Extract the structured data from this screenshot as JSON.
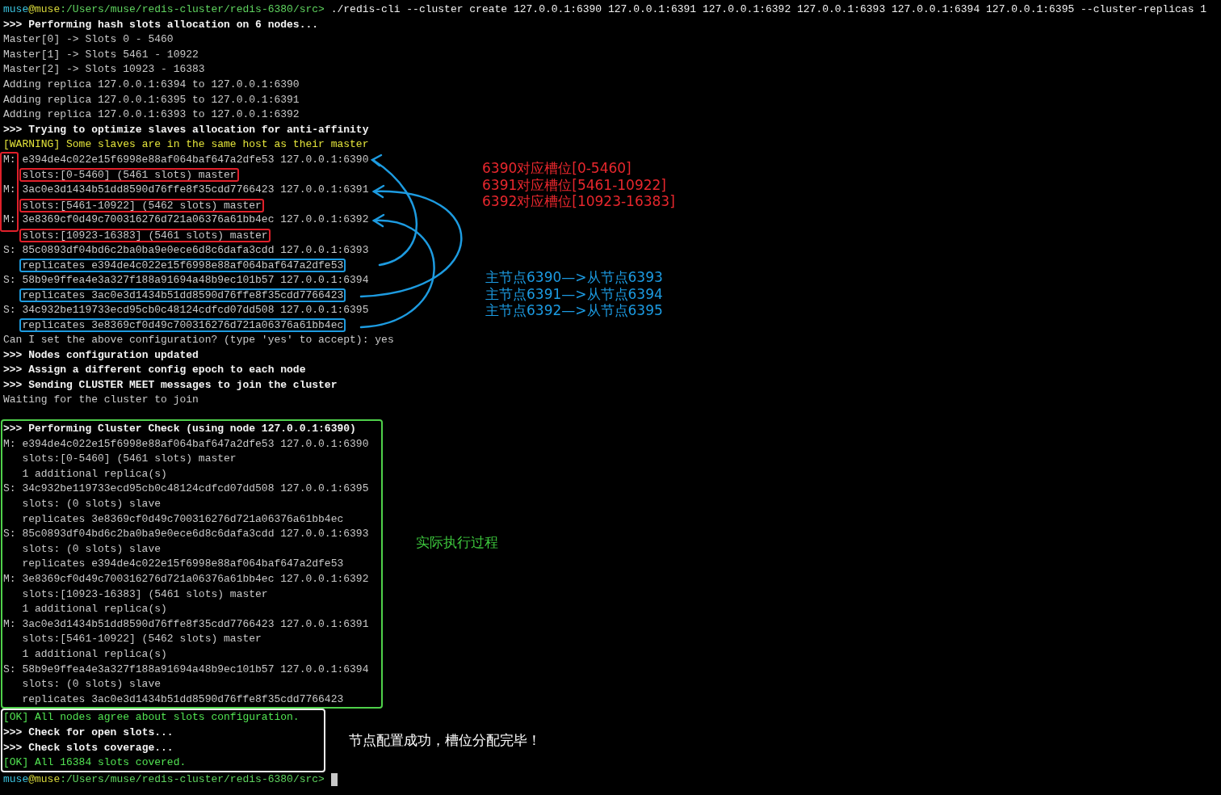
{
  "sections": [
    {
      "kind": "plain",
      "lines": [
        {
          "kind": "prompt",
          "parts": [
            {
              "kind": "user",
              "text": "muse"
            },
            {
              "kind": "host",
              "text": "@muse"
            },
            {
              "kind": "path",
              "text": ":/Users/muse/redis-cluster/redis-6380/src>"
            },
            {
              "kind": "command",
              "text": " ./redis-cli --cluster create 127.0.0.1:6390 127.0.0.1:6391 127.0.0.1:6392 127.0.0.1:6393 127.0.0.1:6394 127.0.0.1:6395 --cluster-replicas 1"
            }
          ]
        },
        {
          "kind": "step",
          "text": ">>> Performing hash slots allocation on 6 nodes..."
        },
        {
          "kind": "plain",
          "text": "Master[0] -> Slots 0 - 5460"
        },
        {
          "kind": "plain",
          "text": "Master[1] -> Slots 5461 - 10922"
        },
        {
          "kind": "plain",
          "text": "Master[2] -> Slots 10923 - 16383"
        },
        {
          "kind": "plain",
          "text": "Adding replica 127.0.0.1:6394 to 127.0.0.1:6390"
        },
        {
          "kind": "plain",
          "text": "Adding replica 127.0.0.1:6395 to 127.0.0.1:6391"
        },
        {
          "kind": "plain",
          "text": "Adding replica 127.0.0.1:6393 to 127.0.0.1:6392"
        },
        {
          "kind": "step",
          "text": ">>> Trying to optimize slaves allocation for anti-affinity"
        },
        {
          "kind": "warning",
          "text": "[WARNING] Some slaves are in the same host as their master"
        },
        {
          "kind": "node",
          "tag": "M:",
          "text": "e394de4c022e15f6998e88af064baf647a2dfe53 127.0.0.1:6390",
          "bracket": true
        },
        {
          "kind": "detail",
          "text": "slots:[0-5460] (5461 slots) master",
          "color": "#e0202a",
          "bracket": true
        },
        {
          "kind": "node",
          "tag": "M:",
          "text": "3ac0e3d1434b51dd8590d76ffe8f35cdd7766423 127.0.0.1:6391",
          "bracket": true
        },
        {
          "kind": "detail",
          "text": "slots:[5461-10922] (5462 slots) master",
          "color": "#e0202a",
          "bracket": true
        },
        {
          "kind": "node",
          "tag": "M:",
          "text": "3e8369cf0d49c700316276d721a06376a61bb4ec 127.0.0.1:6392",
          "bracket": true
        },
        {
          "kind": "detail",
          "text": "slots:[10923-16383] (5461 slots) master",
          "color": "#e0202a"
        },
        {
          "kind": "node",
          "tag": "S:",
          "text": "85c0893df04bd6c2ba0ba9e0ece6d8c6dafa3cdd 127.0.0.1:6393"
        },
        {
          "kind": "detail",
          "text": "replicates e394de4c022e15f6998e88af064baf647a2dfe53",
          "color": "#1d9be0"
        },
        {
          "kind": "node",
          "tag": "S:",
          "text": "58b9e9ffea4e3a327f188a91694a48b9ec101b57 127.0.0.1:6394"
        },
        {
          "kind": "detail",
          "text": "replicates 3ac0e3d1434b51dd8590d76ffe8f35cdd7766423",
          "color": "#1d9be0"
        },
        {
          "kind": "node",
          "tag": "S:",
          "text": "34c932be119733ecd95cb0c48124cdfcd07dd508 127.0.0.1:6395"
        },
        {
          "kind": "detail",
          "text": "replicates 3e8369cf0d49c700316276d721a06376a61bb4ec",
          "color": "#1d9be0"
        },
        {
          "kind": "plain",
          "text": "Can I set the above configuration? (type 'yes' to accept): yes"
        },
        {
          "kind": "step",
          "text": ">>> Nodes configuration updated"
        },
        {
          "kind": "step",
          "text": ">>> Assign a different config epoch to each node"
        },
        {
          "kind": "step",
          "text": ">>> Sending CLUSTER MEET messages to join the cluster"
        },
        {
          "kind": "plain",
          "text": "Waiting for the cluster to join"
        }
      ]
    },
    {
      "kind": "green",
      "lines": [
        {
          "kind": "step",
          "text": ">>> Performing Cluster Check (using node 127.0.0.1:6390)"
        },
        {
          "kind": "node",
          "tag": "M:",
          "text": "e394de4c022e15f6998e88af064baf647a2dfe53 127.0.0.1:6390"
        },
        {
          "kind": "detail",
          "text": "slots:[0-5460] (5461 slots) master"
        },
        {
          "kind": "detail",
          "text": "1 additional replica(s)"
        },
        {
          "kind": "node",
          "tag": "S:",
          "text": "34c932be119733ecd95cb0c48124cdfcd07dd508 127.0.0.1:6395"
        },
        {
          "kind": "detail",
          "text": "slots: (0 slots) slave"
        },
        {
          "kind": "detail",
          "text": "replicates 3e8369cf0d49c700316276d721a06376a61bb4ec"
        },
        {
          "kind": "node",
          "tag": "S:",
          "text": "85c0893df04bd6c2ba0ba9e0ece6d8c6dafa3cdd 127.0.0.1:6393"
        },
        {
          "kind": "detail",
          "text": "slots: (0 slots) slave"
        },
        {
          "kind": "detail",
          "text": "replicates e394de4c022e15f6998e88af064baf647a2dfe53"
        },
        {
          "kind": "node",
          "tag": "M:",
          "text": "3e8369cf0d49c700316276d721a06376a61bb4ec 127.0.0.1:6392"
        },
        {
          "kind": "detail",
          "text": "slots:[10923-16383] (5461 slots) master"
        },
        {
          "kind": "detail",
          "text": "1 additional replica(s)"
        },
        {
          "kind": "node",
          "tag": "M:",
          "text": "3ac0e3d1434b51dd8590d76ffe8f35cdd7766423 127.0.0.1:6391"
        },
        {
          "kind": "detail",
          "text": "slots:[5461-10922] (5462 slots) master"
        },
        {
          "kind": "detail",
          "text": "1 additional replica(s)"
        },
        {
          "kind": "node",
          "tag": "S:",
          "text": "58b9e9ffea4e3a327f188a91694a48b9ec101b57 127.0.0.1:6394"
        },
        {
          "kind": "detail",
          "text": "slots: (0 slots) slave"
        },
        {
          "kind": "detail",
          "text": "replicates 3ac0e3d1434b51dd8590d76ffe8f35cdd7766423"
        }
      ]
    },
    {
      "kind": "white",
      "lines": [
        {
          "kind": "ok",
          "text": "[OK] All nodes agree about slots configuration."
        },
        {
          "kind": "step",
          "text": ">>> Check for open slots..."
        },
        {
          "kind": "step",
          "text": ">>> Check slots coverage..."
        },
        {
          "kind": "ok",
          "text": "[OK] All 16384 slots covered."
        }
      ]
    },
    {
      "kind": "plain",
      "lines": [
        {
          "kind": "prompt",
          "parts": [
            {
              "kind": "user",
              "text": "muse"
            },
            {
              "kind": "host",
              "text": "@muse"
            },
            {
              "kind": "path",
              "text": ":/Users/muse/redis-cluster/redis-6380/src>"
            }
          ],
          "cursor": true
        }
      ]
    }
  ],
  "notes": [
    {
      "kind": "slots",
      "color": "#e8272d",
      "lines": [
        "6390对应槽位[0-5460]",
        "6391对应槽位[5461-10922]",
        "6392对应槽位[10923-16383]"
      ]
    },
    {
      "kind": "replicas",
      "color": "#1c9be2",
      "lines": [
        "主节点6390—>从节点6393",
        "主节点6391—>从节点6394",
        "主节点6392—>从节点6395"
      ]
    },
    {
      "kind": "check",
      "color": "#3cc43c",
      "lines": [
        "实际执行过程"
      ]
    },
    {
      "kind": "result",
      "color": "#ffffff",
      "lines": [
        "节点配置成功，槽位分配完毕！"
      ]
    }
  ]
}
